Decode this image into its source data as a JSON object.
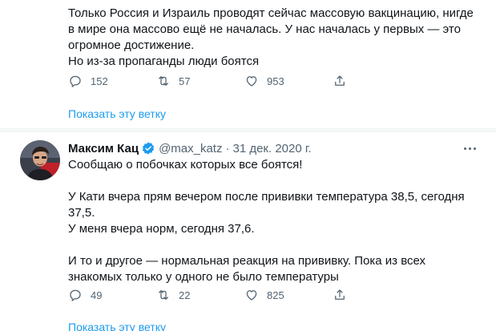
{
  "tweet1": {
    "lines": [
      "Только Россия и Израиль проводят сейчас массовую вакцинацию, нигде",
      "в мире она массово ещё не началась. У нас началась у первых — это",
      "огромное достижение.",
      "Но из-за пропаганды люди боятся"
    ],
    "replies": "152",
    "retweets": "57",
    "likes": "953",
    "show_thread": "Показать эту ветку"
  },
  "tweet2": {
    "name": "Максим Кац",
    "handle": "@max_katz",
    "separator": "·",
    "date": "31 дек. 2020 г.",
    "lines": [
      "Сообщаю о побочках которых все боятся!",
      "",
      "У Кати вчера прям вечером после прививки температура 38,5, сегодня",
      "37,5.",
      "У меня вчера норм, сегодня 37,6.",
      "",
      "И то и другое — нормальная реакция на прививку. Пока из всех",
      "знакомых только у одного не было температуры"
    ],
    "replies": "49",
    "retweets": "22",
    "likes": "825",
    "show_thread": "Показать эту ветку"
  },
  "icons": {
    "reply": "reply-icon",
    "retweet": "retweet-icon",
    "like": "heart-icon",
    "share": "share-icon",
    "verified": "verified-badge-icon",
    "more": "more-options-icon"
  },
  "colors": {
    "text": "#0f1419",
    "secondary": "#536471",
    "link": "#1d9bf0",
    "divider": "#eff3f4"
  }
}
